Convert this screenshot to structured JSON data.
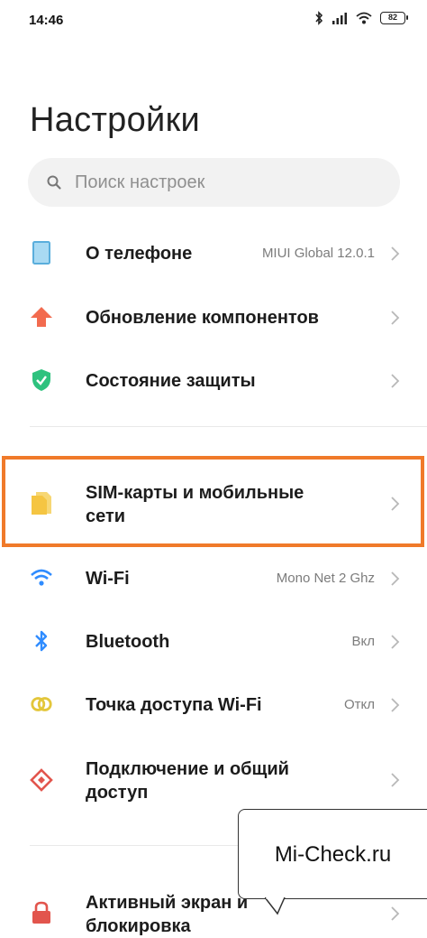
{
  "status_bar": {
    "time": "14:46",
    "battery": "82"
  },
  "header": {
    "title": "Настройки"
  },
  "search": {
    "placeholder": "Поиск настроек"
  },
  "rows": [
    {
      "label": "О телефоне",
      "value": "MIUI Global 12.0.1",
      "icon": "phone-icon"
    },
    {
      "label": "Обновление компонентов",
      "value": "",
      "icon": "update-arrow-icon"
    },
    {
      "label": "Состояние защиты",
      "value": "",
      "icon": "shield-check-icon"
    },
    {
      "label_line1": "SIM-карты и мобильные",
      "label_line2": "сети",
      "value": "",
      "icon": "sim-card-icon"
    },
    {
      "label": "Wi-Fi",
      "value": "Mono Net 2 Ghz",
      "icon": "wifi-icon"
    },
    {
      "label": "Bluetooth",
      "value": "Вкл",
      "icon": "bluetooth-icon"
    },
    {
      "label": "Точка доступа Wi-Fi",
      "value": "Откл",
      "icon": "hotspot-icon"
    },
    {
      "label_line1": "Подключение и общий",
      "label_line2": "доступ",
      "value": "",
      "icon": "connection-sharing-icon"
    },
    {
      "label_line1": "Активный экран и",
      "label_line2": "блокировка",
      "value": "",
      "icon": "lock-icon"
    }
  ],
  "watermark": {
    "text": "Mi-Check.ru"
  },
  "colors": {
    "highlight": "#f07a2a",
    "sim": "#f5c542",
    "update": "#f26b4f",
    "shield": "#2ec27e",
    "wifi": "#2f8cff",
    "bluetooth": "#2f8cff",
    "hotspot": "#e3c63a",
    "connection": "#e2554d",
    "lock": "#e2554d",
    "phone": "#7ec3ea"
  }
}
